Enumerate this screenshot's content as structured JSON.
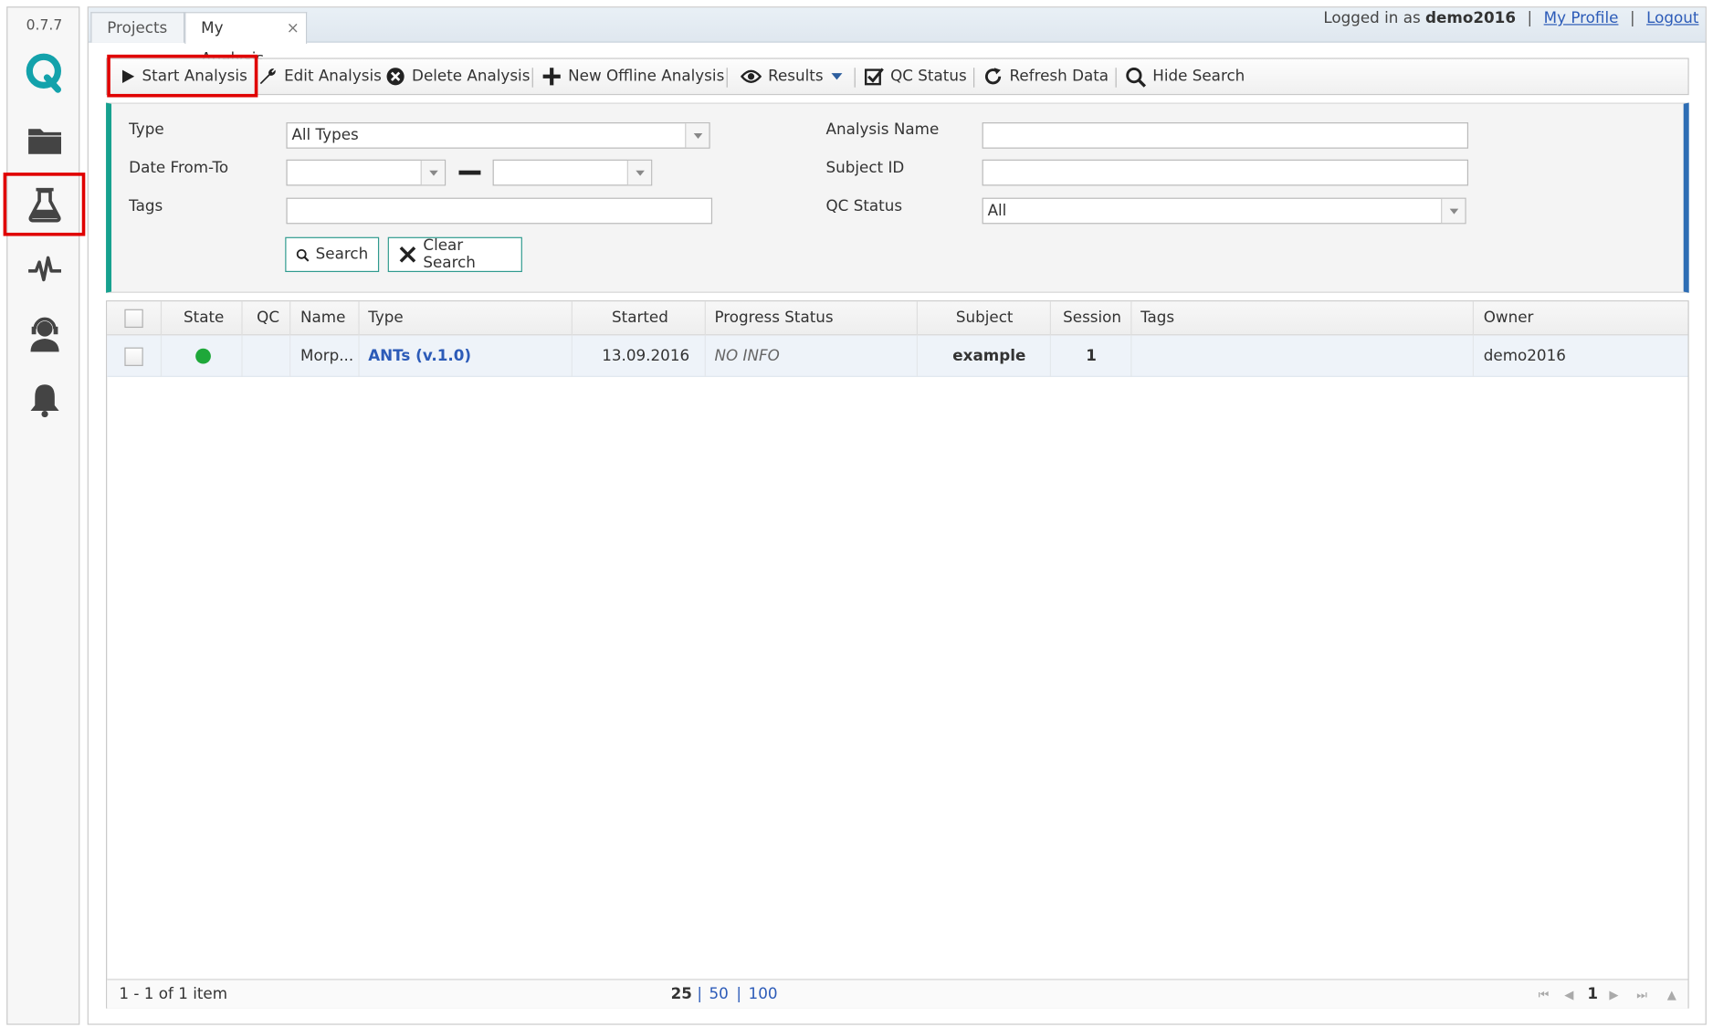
{
  "app": {
    "version": "0.7.7"
  },
  "sidebar": {
    "items": [
      {
        "icon": "logo-q-icon"
      },
      {
        "icon": "folder-icon"
      },
      {
        "icon": "flask-icon",
        "active": true
      },
      {
        "icon": "pulse-icon"
      },
      {
        "icon": "support-agent-icon"
      },
      {
        "icon": "bell-icon"
      }
    ]
  },
  "tabs": [
    {
      "label": "Projects",
      "active": false
    },
    {
      "label": "My Analysis",
      "active": true,
      "close": "×"
    }
  ],
  "user": {
    "prefix": "Logged in as",
    "username": "demo2016",
    "sep": "|",
    "profile": "My Profile",
    "logout": "Logout"
  },
  "toolbar": {
    "start": "Start Analysis",
    "edit": "Edit Analysis",
    "delete": "Delete Analysis",
    "new_offline": "New Offline Analysis",
    "results": "Results",
    "qc_status": "QC Status",
    "refresh": "Refresh Data",
    "hide_search": "Hide Search"
  },
  "search": {
    "type_label": "Type",
    "type_value": "All Types",
    "date_label": "Date From-To",
    "date_from": "",
    "date_to": "",
    "tags_label": "Tags",
    "tags_value": "",
    "analysis_name_label": "Analysis Name",
    "analysis_name_value": "",
    "subject_id_label": "Subject ID",
    "subject_id_value": "",
    "qc_status_label": "QC Status",
    "qc_status_value": "All",
    "search_button": "Search",
    "clear_button": "Clear Search"
  },
  "grid": {
    "columns": [
      "State",
      "QC",
      "Name",
      "Type",
      "Started",
      "Progress Status",
      "Subject",
      "Session",
      "Tags",
      "Owner"
    ],
    "rows": [
      {
        "state_color": "#1ea83a",
        "qc": "",
        "name": "Morp...",
        "type": "ANTs (v.1.0)",
        "started": "13.09.2016",
        "progress_status": "NO INFO",
        "subject": "example",
        "session": "1",
        "tags": "",
        "owner": "demo2016"
      }
    ]
  },
  "footer": {
    "summary": "1 - 1 of 1 item",
    "page_sizes": [
      "25",
      "50",
      "100"
    ],
    "page_sep": "|",
    "current_page": "1"
  },
  "colors": {
    "highlight": "#e00000",
    "accent_teal": "#17a18f",
    "accent_blue": "#2d6db4",
    "link": "#2c5bb8"
  }
}
